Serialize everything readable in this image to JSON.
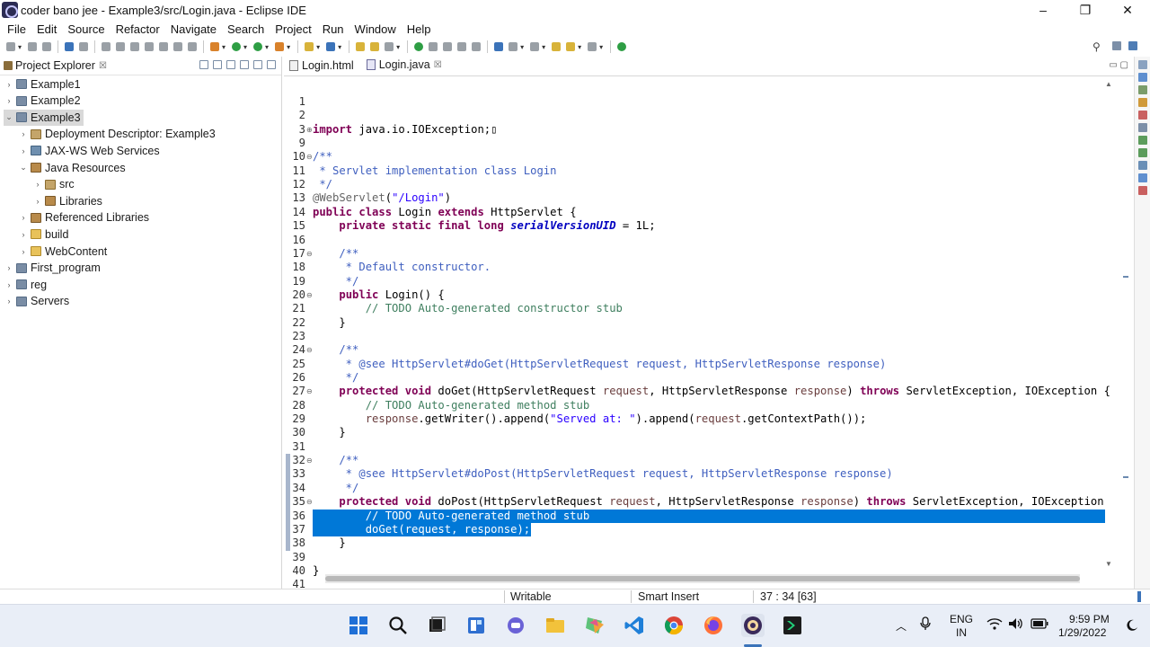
{
  "window": {
    "title": "coder bano jee - Example3/src/Login.java - Eclipse IDE",
    "minimize": "–",
    "restore": "❐",
    "close": "✕"
  },
  "menu": [
    "File",
    "Edit",
    "Source",
    "Refactor",
    "Navigate",
    "Search",
    "Project",
    "Run",
    "Window",
    "Help"
  ],
  "explorer": {
    "title": "Project Explorer",
    "close": "☒",
    "items": [
      {
        "label": "Example1",
        "level": 0,
        "twisty": "›",
        "icon": "project"
      },
      {
        "label": "Example2",
        "level": 0,
        "twisty": "›",
        "icon": "project"
      },
      {
        "label": "Example3",
        "level": 0,
        "twisty": "⌄",
        "icon": "project",
        "selected": true
      },
      {
        "label": "Deployment Descriptor: Example3",
        "level": 1,
        "twisty": "›",
        "icon": "pkg"
      },
      {
        "label": "JAX-WS Web Services",
        "level": 1,
        "twisty": "›",
        "icon": "srv"
      },
      {
        "label": "Java Resources",
        "level": 1,
        "twisty": "⌄",
        "icon": "jar"
      },
      {
        "label": "src",
        "level": 2,
        "twisty": "›",
        "icon": "pkg"
      },
      {
        "label": "Libraries",
        "level": 2,
        "twisty": "›",
        "icon": "jar"
      },
      {
        "label": "Referenced Libraries",
        "level": 1,
        "twisty": "›",
        "icon": "jar"
      },
      {
        "label": "build",
        "level": 1,
        "twisty": "›",
        "icon": "folder"
      },
      {
        "label": "WebContent",
        "level": 1,
        "twisty": "›",
        "icon": "folder"
      },
      {
        "label": "First_program",
        "level": 0,
        "twisty": "›",
        "icon": "project"
      },
      {
        "label": "reg",
        "level": 0,
        "twisty": "›",
        "icon": "project"
      },
      {
        "label": "Servers",
        "level": 0,
        "twisty": "›",
        "icon": "project"
      }
    ]
  },
  "editor": {
    "tabs": [
      {
        "label": "Login.html",
        "active": false,
        "icon": "html-file-icon"
      },
      {
        "label": "Login.java",
        "active": true,
        "icon": "java-file-icon",
        "close": "☒"
      }
    ],
    "lines": [
      {
        "n": "1",
        "tokens": []
      },
      {
        "n": "2",
        "tokens": []
      },
      {
        "n": "3",
        "fold": "⊕",
        "tokens": [
          {
            "t": "import",
            "c": "kw"
          },
          {
            "t": " java.io.IOException;▯"
          }
        ]
      },
      {
        "n": "9",
        "tokens": []
      },
      {
        "n": "10",
        "fold": "⊖",
        "tokens": [
          {
            "t": "/**",
            "c": "jd"
          }
        ]
      },
      {
        "n": "11",
        "tokens": [
          {
            "t": " * Servlet implementation class Login",
            "c": "jd"
          }
        ]
      },
      {
        "n": "12",
        "tokens": [
          {
            "t": " */",
            "c": "jd"
          }
        ]
      },
      {
        "n": "13",
        "tokens": [
          {
            "t": "@WebServlet",
            "c": "ann"
          },
          {
            "t": "("
          },
          {
            "t": "\"/Login\"",
            "c": "str"
          },
          {
            "t": ")"
          }
        ]
      },
      {
        "n": "14",
        "tokens": [
          {
            "t": "public class",
            "c": "kw"
          },
          {
            "t": " Login "
          },
          {
            "t": "extends",
            "c": "kw"
          },
          {
            "t": " HttpServlet {"
          }
        ]
      },
      {
        "n": "15",
        "tokens": [
          {
            "t": "    "
          },
          {
            "t": "private static final long",
            "c": "kw"
          },
          {
            "t": " "
          },
          {
            "t": "serialVersionUID",
            "c": "fld"
          },
          {
            "t": " = 1L;"
          }
        ]
      },
      {
        "n": "16",
        "tokens": []
      },
      {
        "n": "17",
        "fold": "⊖",
        "tokens": [
          {
            "t": "    "
          },
          {
            "t": "/**",
            "c": "jd"
          }
        ]
      },
      {
        "n": "18",
        "tokens": [
          {
            "t": "     * Default constructor.",
            "c": "jd"
          }
        ]
      },
      {
        "n": "19",
        "tokens": [
          {
            "t": "     */",
            "c": "jd"
          }
        ]
      },
      {
        "n": "20",
        "fold": "⊖",
        "tokens": [
          {
            "t": "    "
          },
          {
            "t": "public",
            "c": "kw"
          },
          {
            "t": " Login() {"
          }
        ]
      },
      {
        "n": "21",
        "tokens": [
          {
            "t": "        "
          },
          {
            "t": "// TODO Auto-generated constructor stub",
            "c": "cm"
          }
        ]
      },
      {
        "n": "22",
        "tokens": [
          {
            "t": "    }"
          }
        ]
      },
      {
        "n": "23",
        "tokens": []
      },
      {
        "n": "24",
        "fold": "⊖",
        "tokens": [
          {
            "t": "    "
          },
          {
            "t": "/**",
            "c": "jd"
          }
        ]
      },
      {
        "n": "25",
        "tokens": [
          {
            "t": "     * @see HttpServlet#doGet(HttpServletRequest request, HttpServletResponse response)",
            "c": "jd"
          }
        ]
      },
      {
        "n": "26",
        "tokens": [
          {
            "t": "     */",
            "c": "jd"
          }
        ]
      },
      {
        "n": "27",
        "fold": "⊖",
        "tokens": [
          {
            "t": "    "
          },
          {
            "t": "protected void",
            "c": "kw"
          },
          {
            "t": " doGet(HttpServletRequest "
          },
          {
            "t": "request",
            "c": "param"
          },
          {
            "t": ", HttpServletResponse "
          },
          {
            "t": "response",
            "c": "param"
          },
          {
            "t": ") "
          },
          {
            "t": "throws",
            "c": "kw"
          },
          {
            "t": " ServletException, IOException {"
          }
        ]
      },
      {
        "n": "28",
        "tokens": [
          {
            "t": "        "
          },
          {
            "t": "// TODO Auto-generated method stub",
            "c": "cm"
          }
        ]
      },
      {
        "n": "29",
        "tokens": [
          {
            "t": "        "
          },
          {
            "t": "response",
            "c": "param"
          },
          {
            "t": ".getWriter().append("
          },
          {
            "t": "\"Served at: \"",
            "c": "str"
          },
          {
            "t": ").append("
          },
          {
            "t": "request",
            "c": "param"
          },
          {
            "t": ".getContextPath());"
          }
        ]
      },
      {
        "n": "30",
        "tokens": [
          {
            "t": "    }"
          }
        ]
      },
      {
        "n": "31",
        "tokens": []
      },
      {
        "n": "32",
        "fold": "⊖",
        "tokens": [
          {
            "t": "    "
          },
          {
            "t": "/**",
            "c": "jd"
          }
        ]
      },
      {
        "n": "33",
        "tokens": [
          {
            "t": "     * @see HttpServlet#doPost(HttpServletRequest request, HttpServletResponse response)",
            "c": "jd"
          }
        ]
      },
      {
        "n": "34",
        "tokens": [
          {
            "t": "     */",
            "c": "jd"
          }
        ]
      },
      {
        "n": "35",
        "fold": "⊖",
        "tokens": [
          {
            "t": "    "
          },
          {
            "t": "protected void",
            "c": "kw"
          },
          {
            "t": " doPost(HttpServletRequest "
          },
          {
            "t": "request",
            "c": "param"
          },
          {
            "t": ", HttpServletResponse "
          },
          {
            "t": "response",
            "c": "param"
          },
          {
            "t": ") "
          },
          {
            "t": "throws",
            "c": "kw"
          },
          {
            "t": " ServletException, IOException"
          }
        ]
      },
      {
        "n": "36",
        "selected": true,
        "tokens": [
          {
            "t": "        "
          },
          {
            "t": "// TODO Auto-generated method stub",
            "c": "cm"
          }
        ]
      },
      {
        "n": "37",
        "selected": true,
        "tokens": [
          {
            "t": "        doGet(request, response);"
          }
        ]
      },
      {
        "n": "38",
        "tokens": [
          {
            "t": "    }"
          }
        ]
      },
      {
        "n": "39",
        "tokens": []
      },
      {
        "n": "40",
        "tokens": [
          {
            "t": "}"
          }
        ]
      },
      {
        "n": "41",
        "tokens": []
      }
    ]
  },
  "status": {
    "writable": "Writable",
    "insert_mode": "Smart Insert",
    "position": "37 : 34 [63]"
  },
  "taskbar": {
    "language_top": "ENG",
    "language_bottom": "IN",
    "time": "9:59 PM",
    "date": "1/29/2022"
  },
  "colors": {
    "selection": "#0078d7",
    "keyword": "#7f0055",
    "comment": "#3f7f5f",
    "javadoc": "#3f5fbf",
    "string": "#2a00ff"
  }
}
